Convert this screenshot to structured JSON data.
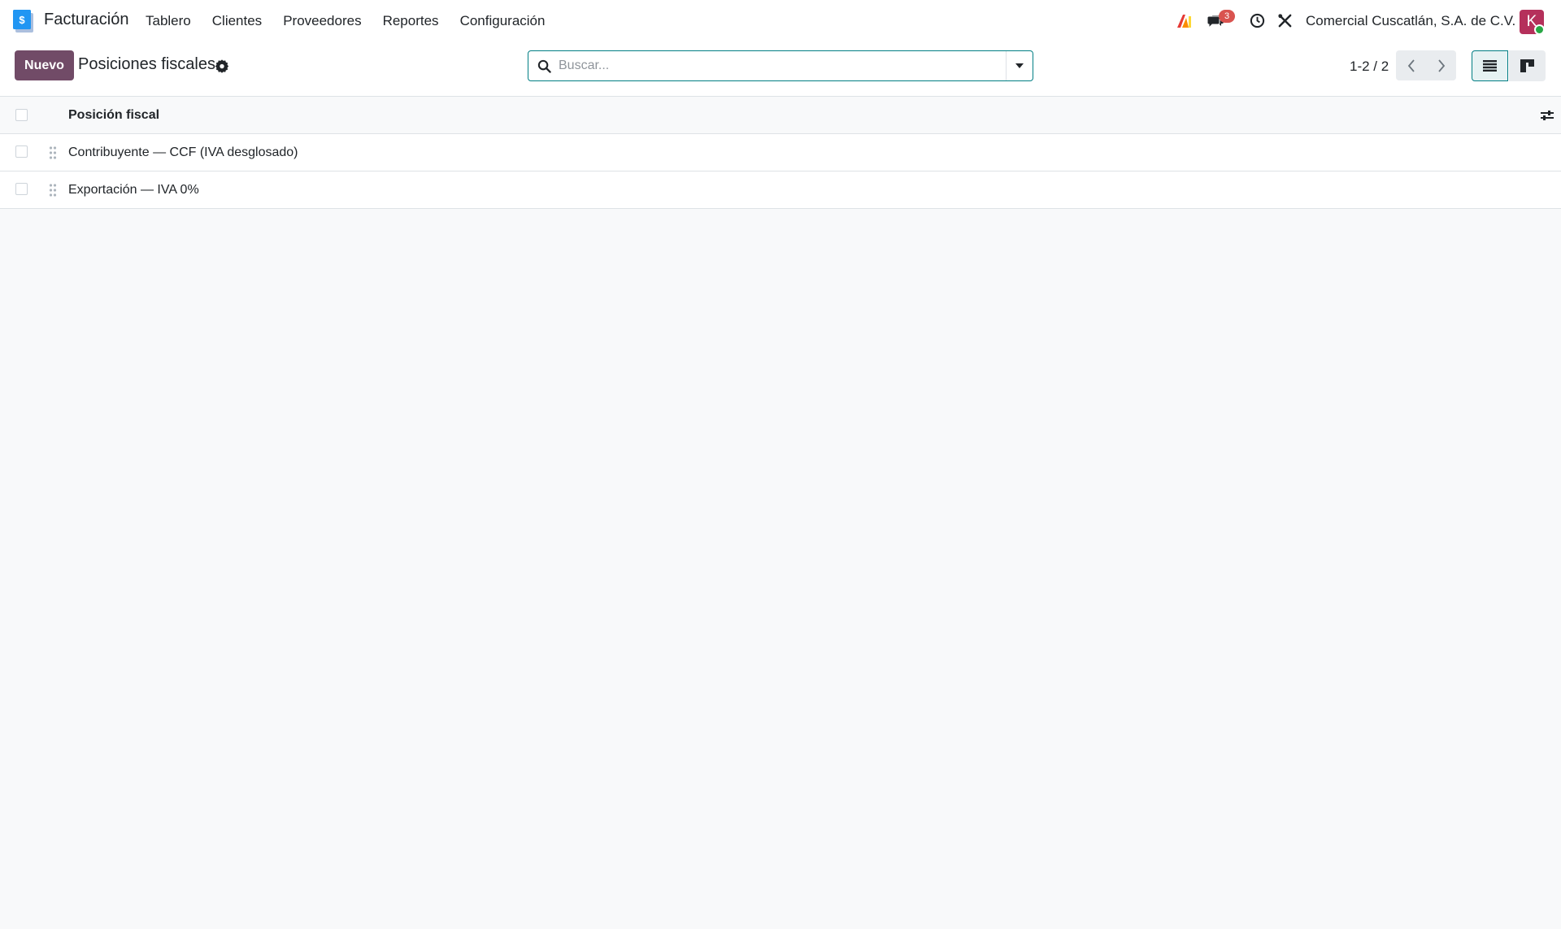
{
  "navbar": {
    "app_name": "Facturación",
    "menu": [
      "Tablero",
      "Clientes",
      "Proveedores",
      "Reportes",
      "Configuración"
    ],
    "messages_badge": "3",
    "company": "Comercial Cuscatlán, S.A. de C.V.",
    "avatar_letter": "K",
    "icons": [
      "app-logo-icon",
      "ai-icon",
      "chat-icon",
      "clock-icon",
      "tools-icon"
    ]
  },
  "control": {
    "new_label": "Nuevo",
    "title": "Posiciones fiscales",
    "search_placeholder": "Buscar...",
    "pager": "1-2 / 2"
  },
  "list": {
    "column": "Posición fiscal",
    "rows": [
      "Contribuyente — CCF (IVA desglosado)",
      "Exportación — IVA 0%"
    ]
  },
  "colors": {
    "primary": "#714b67",
    "accent": "#017e84",
    "badge": "#d9534f",
    "avatar": "#b5305b"
  }
}
